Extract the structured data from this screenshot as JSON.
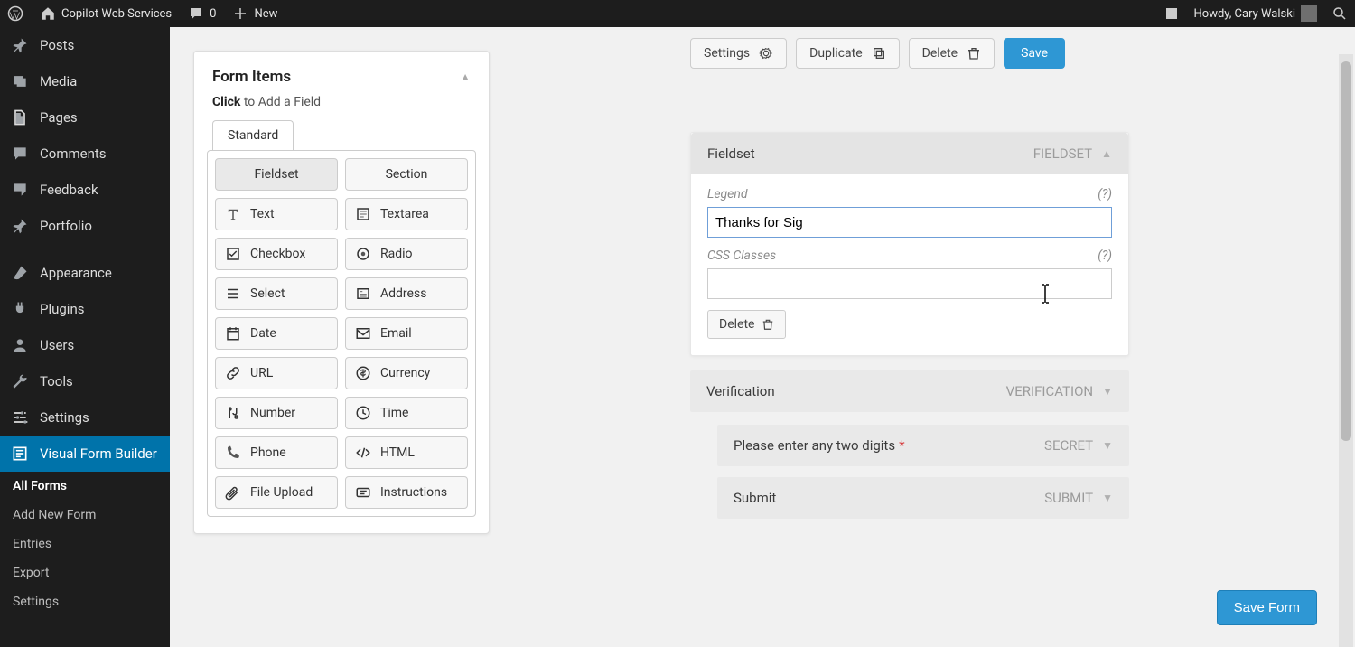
{
  "adminbar": {
    "site": "Copilot Web Services",
    "comments": "0",
    "new": "New",
    "howdy": "Howdy, Cary Walski"
  },
  "sidebar": {
    "items": [
      {
        "label": "Posts",
        "icon": "pin"
      },
      {
        "label": "Media",
        "icon": "media"
      },
      {
        "label": "Pages",
        "icon": "page"
      },
      {
        "label": "Comments",
        "icon": "comment"
      },
      {
        "label": "Feedback",
        "icon": "feedback"
      },
      {
        "label": "Portfolio",
        "icon": "pin"
      }
    ],
    "items2": [
      {
        "label": "Appearance",
        "icon": "brush"
      },
      {
        "label": "Plugins",
        "icon": "plug"
      },
      {
        "label": "Users",
        "icon": "user"
      },
      {
        "label": "Tools",
        "icon": "wrench"
      },
      {
        "label": "Settings",
        "icon": "sliders"
      }
    ],
    "current": {
      "label": "Visual Form Builder",
      "icon": "form"
    },
    "submenu": [
      "All Forms",
      "Add New Form",
      "Entries",
      "Export",
      "Settings"
    ]
  },
  "formItems": {
    "title": "Form Items",
    "hint_strong": "Click",
    "hint_rest": " to Add a Field",
    "tab": "Standard",
    "buttons": [
      {
        "label": "Fieldset",
        "icon": null,
        "active": true
      },
      {
        "label": "Section",
        "icon": null
      },
      {
        "label": "Text",
        "icon": "text"
      },
      {
        "label": "Textarea",
        "icon": "textarea"
      },
      {
        "label": "Checkbox",
        "icon": "checkbox"
      },
      {
        "label": "Radio",
        "icon": "radio"
      },
      {
        "label": "Select",
        "icon": "select"
      },
      {
        "label": "Address",
        "icon": "address"
      },
      {
        "label": "Date",
        "icon": "date"
      },
      {
        "label": "Email",
        "icon": "email"
      },
      {
        "label": "URL",
        "icon": "url"
      },
      {
        "label": "Currency",
        "icon": "currency"
      },
      {
        "label": "Number",
        "icon": "number"
      },
      {
        "label": "Time",
        "icon": "time"
      },
      {
        "label": "Phone",
        "icon": "phone"
      },
      {
        "label": "HTML",
        "icon": "html"
      },
      {
        "label": "File Upload",
        "icon": "file"
      },
      {
        "label": "Instructions",
        "icon": "instructions"
      }
    ]
  },
  "toolbar": {
    "settings": "Settings",
    "duplicate": "Duplicate",
    "delete": "Delete",
    "save": "Save"
  },
  "editor": {
    "fieldset": {
      "title": "Fieldset",
      "type": "FIELDSET",
      "legend_label": "Legend",
      "legend_value": "Thanks for Sig",
      "css_label": "CSS Classes",
      "css_value": "",
      "help": "(?)",
      "delete": "Delete"
    },
    "verification": {
      "title": "Verification",
      "type": "VERIFICATION"
    },
    "secret": {
      "title": "Please enter any two digits",
      "required": "*",
      "type": "SECRET"
    },
    "submit": {
      "title": "Submit",
      "type": "SUBMIT"
    },
    "save_form": "Save Form"
  }
}
